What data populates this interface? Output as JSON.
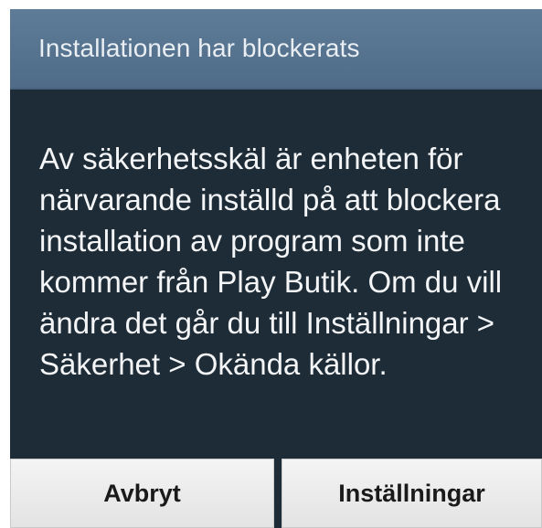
{
  "dialog": {
    "title": "Installationen har blockerats",
    "message": "Av säkerhetsskäl är enheten för närvarande inställd på att blockera installation av program som inte kommer från Play Butik. Om du vill ändra det går du till Inställningar > Säkerhet > Okända källor.",
    "buttons": {
      "cancel_label": "Avbryt",
      "settings_label": "Inställningar"
    }
  },
  "colors": {
    "header_background": "#55728f",
    "body_background": "#1e2c37",
    "text": "#f3f5f7",
    "button_background": "#ececec"
  }
}
